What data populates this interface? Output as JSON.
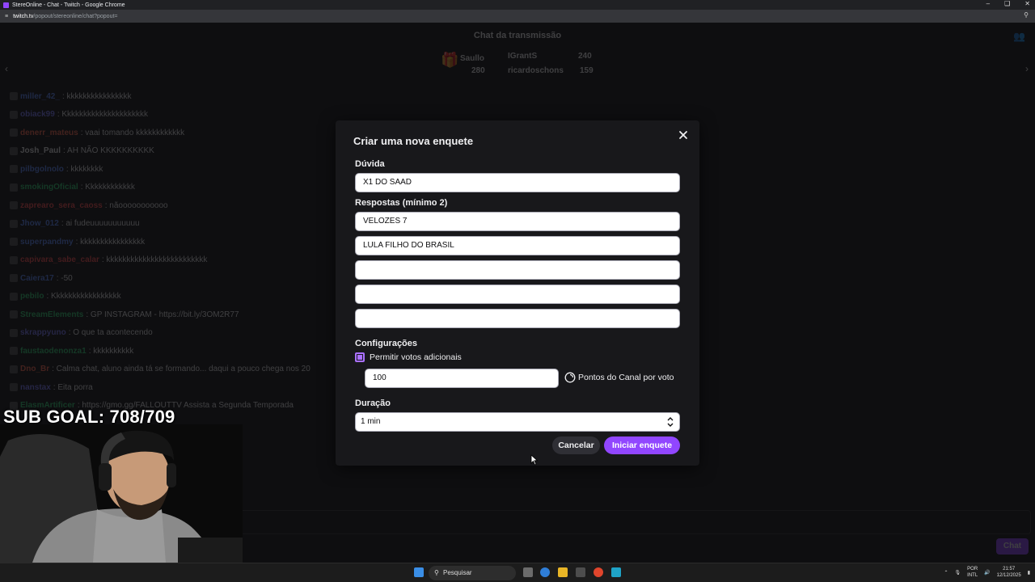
{
  "browser": {
    "title": "StereOnline - Chat - Twitch - Google Chrome",
    "url_host": "twitch.tv",
    "url_path": "/popout/stereonline/chat?popout="
  },
  "chat": {
    "header": "Chat da transmissão",
    "leaderboard": [
      {
        "name": "Saullo",
        "count": "280"
      },
      {
        "name": "IGrantS",
        "count": "240"
      },
      {
        "name": "ricardoschons",
        "count": "159"
      }
    ],
    "messages": [
      {
        "user": "miller_42_",
        "text": ": kkkkkkkkkkkkkkkk",
        "color": "#5c8aff"
      },
      {
        "user": "obiack99",
        "text": ": Kkkkkkkkkkkkkkkkkkkkk",
        "color": "#7a7aff"
      },
      {
        "user": "denerr_mateus",
        "text": ": vaai tomando kkkkkkkkkkkk",
        "color": "#ff6a4d"
      },
      {
        "user": "Josh_Paul",
        "text": ": AH NÃO KKKKKKKKKK",
        "color": "#efeff1"
      },
      {
        "user": "pilbgolnolo",
        "text": ": kkkkkkkk",
        "color": "#5c8aff"
      },
      {
        "user": "smokingOficial",
        "text": ": Kkkkkkkkkkkk",
        "color": "#2ecc71"
      },
      {
        "user": "zaprearo_sera_caoss",
        "text": ": nãooooooooooo",
        "color": "#ff4d4d"
      },
      {
        "user": "Jhow_012",
        "text": ": ai fudeuuuuuuuuuuu",
        "color": "#5c8aff"
      },
      {
        "user": "superpandmy",
        "text": ": kkkkkkkkkkkkkkkk",
        "color": "#5c8aff"
      },
      {
        "user": "capivara_sabe_calar",
        "text": ": kkkkkkkkkkkkkkkkkkkkkkkkk",
        "color": "#ff4d4d"
      },
      {
        "user": "Caiera17",
        "text": ": -50",
        "color": "#5c8aff"
      },
      {
        "user": "pebilo",
        "text": ": Kkkkkkkkkkkkkkkkk",
        "color": "#2ecc71"
      },
      {
        "user": "StreamElements",
        "text": ": GP INSTAGRAM - https://bit.ly/3OM2R77",
        "color": "#2ecc71"
      },
      {
        "user": "skrappyuno",
        "text": ": O que ta acontecendo",
        "color": "#7a7aff"
      },
      {
        "user": "faustaodenonza1",
        "text": ": kkkkkkkkkk",
        "color": "#2ecc71"
      },
      {
        "user": "Dno_Br",
        "text": ": Calma chat, aluno ainda tá se formando... daqui a pouco chega nos 20",
        "color": "#ff6a4d"
      },
      {
        "user": "nanstax",
        "text": ": Eita porra",
        "color": "#7a7aff"
      },
      {
        "user": "ElasmArtificer",
        "text": ": https://gmo.gg/FALLOUTTV Assista a Segunda Temporada",
        "color": "#2ecc71"
      }
    ],
    "send_label": "Chat"
  },
  "overlay": {
    "sub_goal": "SUB GOAL: 708/709"
  },
  "modal": {
    "title": "Criar uma nova enquete",
    "question_label": "Dúvida",
    "question_value": "X1 DO SAAD",
    "answers_label": "Respostas (mínimo 2)",
    "answers": [
      "VELOZES 7",
      "LULA FILHO DO BRASIL",
      "",
      "",
      ""
    ],
    "settings_label": "Configurações",
    "extra_votes_label": "Permitir votos adicionais",
    "extra_votes_checked": true,
    "points_value": "100",
    "points_label": "Pontos do Canal por voto",
    "duration_label": "Duração",
    "duration_value": "1 min",
    "cancel_label": "Cancelar",
    "start_label": "Iniciar enquete",
    "accent_color": "#9146ff"
  },
  "taskbar": {
    "search_placeholder": "Pesquisar",
    "lang_top": "POR",
    "lang_bottom": "INTL",
    "time": "21:57",
    "date": "12/12/2025"
  }
}
